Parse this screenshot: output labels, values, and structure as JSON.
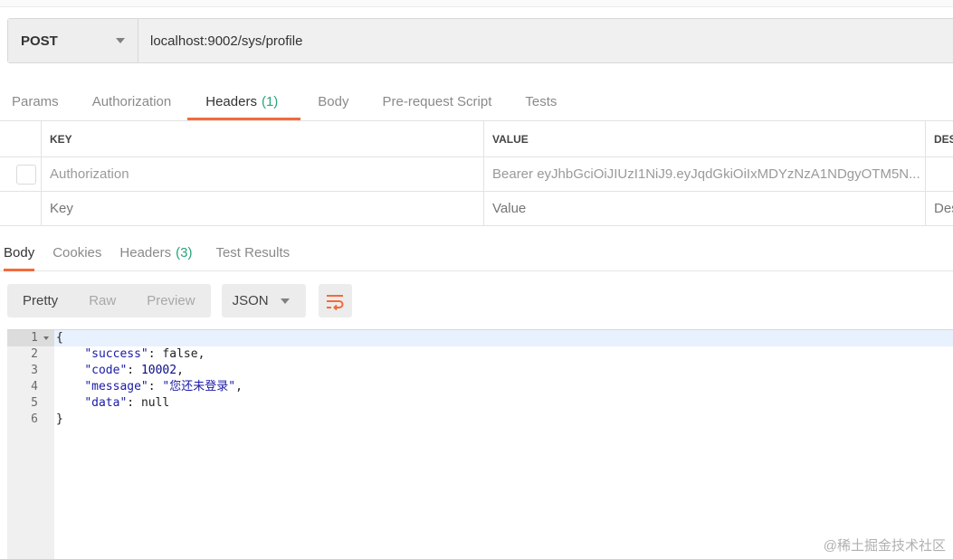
{
  "request": {
    "method": "POST",
    "url": "localhost:9002/sys/profile"
  },
  "request_tabs": [
    {
      "label": "Params"
    },
    {
      "label": "Authorization"
    },
    {
      "label": "Headers",
      "count": "(1)"
    },
    {
      "label": "Body"
    },
    {
      "label": "Pre-request Script"
    },
    {
      "label": "Tests"
    }
  ],
  "headers_table": {
    "columns": {
      "key": "KEY",
      "value": "VALUE",
      "description": "DES"
    },
    "row": {
      "key": "Authorization",
      "value": "Bearer eyJhbGciOiJIUzI1NiJ9.eyJqdGkiOiIxMDYzNzA1NDgyOTM5N..."
    },
    "new_row": {
      "key_placeholder": "Key",
      "value_placeholder": "Value",
      "description_placeholder": "Des"
    }
  },
  "response_tabs": [
    {
      "label": "Body"
    },
    {
      "label": "Cookies"
    },
    {
      "label": "Headers",
      "count": "(3)"
    },
    {
      "label": "Test Results"
    }
  ],
  "view_modes": [
    "Pretty",
    "Raw",
    "Preview"
  ],
  "format": "JSON",
  "accent_color": "#f26b3a",
  "count_color": "#26a37c",
  "body": {
    "line_numbers": [
      "1",
      "2",
      "3",
      "4",
      "5",
      "6"
    ],
    "open_brace": "{",
    "close_brace": "}",
    "success_key": "\"success\"",
    "success_value": "false",
    "code_key": "\"code\"",
    "code_value": "10002",
    "message_key": "\"message\"",
    "message_value": "\"您还未登录\"",
    "data_key": "\"data\"",
    "data_value": "null"
  },
  "watermark": "@稀土掘金技术社区"
}
